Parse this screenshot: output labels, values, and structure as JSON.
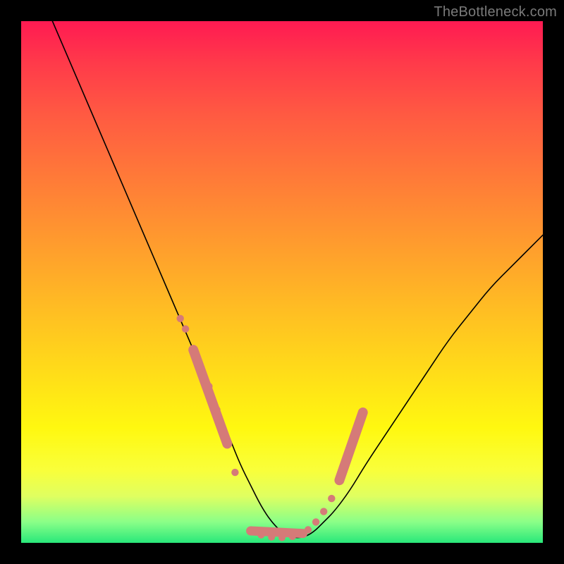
{
  "watermark": "TheBottleneck.com",
  "colors": {
    "page_bg": "#000000",
    "marker": "#d57a78",
    "curve": "#000000"
  },
  "chart_data": {
    "type": "line",
    "title": "",
    "xlabel": "",
    "ylabel": "",
    "xlim": [
      0,
      100
    ],
    "ylim": [
      0,
      100
    ],
    "grid": false,
    "legend": false,
    "series": [
      {
        "name": "bottleneck-curve",
        "x": [
          6,
          9,
          12,
          15,
          18,
          21,
          24,
          27,
          30,
          33,
          36,
          38,
          40,
          42,
          44,
          46,
          48,
          50,
          52,
          54,
          56,
          58,
          60,
          63,
          66,
          70,
          74,
          78,
          82,
          86,
          90,
          94,
          98,
          100
        ],
        "y": [
          100,
          93,
          86,
          79,
          72,
          65,
          58,
          51,
          44,
          37,
          30,
          25,
          20,
          15,
          11,
          7,
          4,
          2,
          1,
          1,
          2,
          4,
          6,
          10,
          15,
          21,
          27,
          33,
          39,
          44,
          49,
          53,
          57,
          59
        ]
      }
    ],
    "markers_left": {
      "name": "markers-left-branch",
      "x": [
        30.5,
        31.5,
        33.0,
        34.5,
        36.0,
        37.5,
        39.5,
        41.0
      ],
      "y": [
        43.0,
        41.0,
        37.0,
        33.5,
        30.0,
        25.5,
        19.0,
        13.5
      ]
    },
    "markers_right": {
      "name": "markers-right-branch",
      "x": [
        55.0,
        56.5,
        58.0,
        59.5,
        61.0,
        62.5,
        64.0,
        65.5
      ],
      "y": [
        2.5,
        4.0,
        6.0,
        8.5,
        12.0,
        16.0,
        20.5,
        25.0
      ]
    },
    "capsule_left": {
      "surround": 4,
      "len_indices": [
        2,
        6
      ]
    },
    "capsule_right": {
      "surround": 3,
      "len_indices": [
        4,
        7
      ]
    },
    "bottom_band": {
      "name": "flat-bottom-markers",
      "x": [
        44,
        46,
        48,
        50,
        52,
        54
      ],
      "y": [
        2.3,
        1.5,
        1.1,
        1.0,
        1.2,
        1.8
      ]
    }
  }
}
